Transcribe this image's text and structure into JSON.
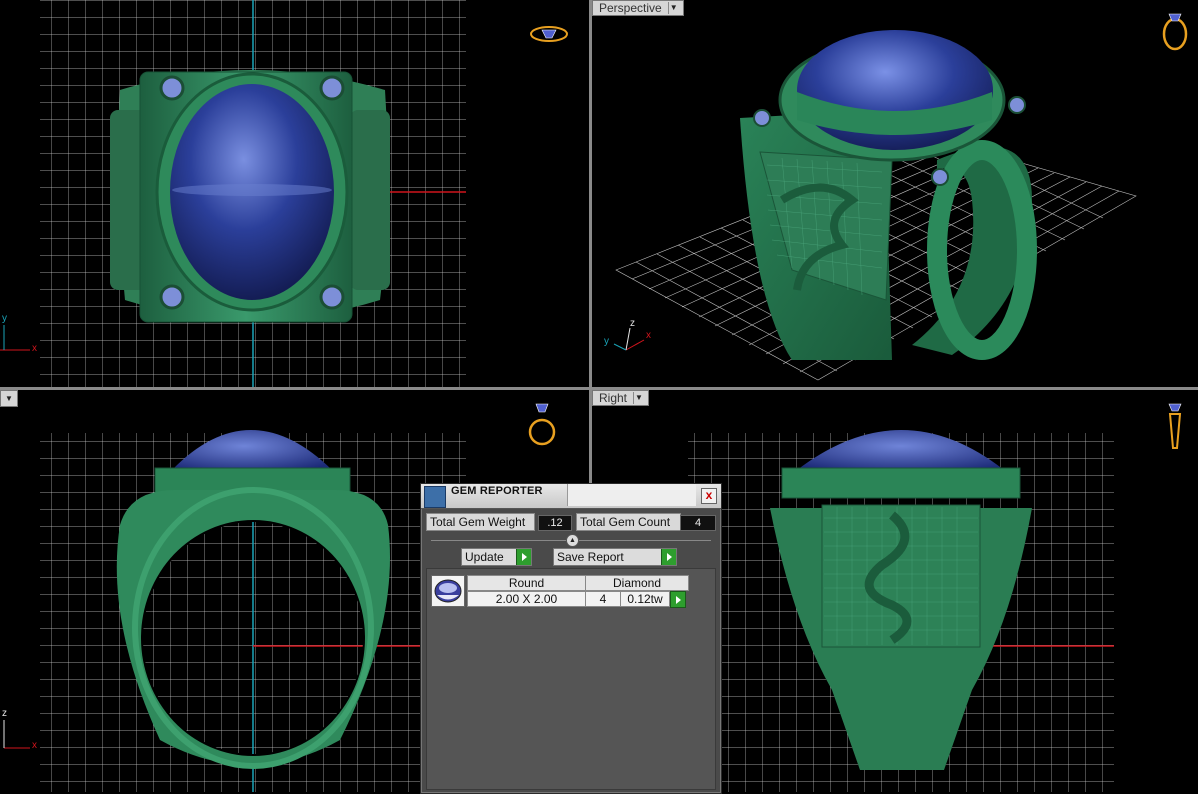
{
  "viewports": {
    "top_left": {
      "label": ""
    },
    "top_right": {
      "label": "Perspective"
    },
    "bottom_left": {
      "label": ""
    },
    "bottom_right": {
      "label": "Right"
    }
  },
  "axes": {
    "top_left": {
      "a": "y",
      "b": "x"
    },
    "top_right": {
      "a": "z",
      "b": "y",
      "c": "x"
    },
    "bottom_left": {
      "a": "z",
      "b": "x"
    }
  },
  "gem_reporter": {
    "title": "GEM REPORTER",
    "close": "x",
    "total_weight_label": "Total Gem Weight",
    "total_weight_value": ".12",
    "total_count_label": "Total Gem Count",
    "total_count_value": "4",
    "update_label": "Update",
    "save_report_label": "Save Report",
    "row": {
      "shape": "Round",
      "type": "Diamond",
      "size": "2.00 X 2.00",
      "count": "4",
      "weight": "0.12tw"
    }
  },
  "colors": {
    "metal": "#2f8a5f",
    "gem": "#2b3f9a",
    "grid": "#d8d8d8",
    "axis_red": "#d0141c",
    "axis_cyan": "#1aa4b8",
    "button_green": "#2e9e2e"
  },
  "icons": [
    "ring-top-view-icon",
    "ring-perspective-icon",
    "ring-front-view-icon",
    "ring-side-view-icon",
    "gem-reporter-icon",
    "close-icon",
    "arrow-right-icon",
    "round-gem-icon"
  ]
}
